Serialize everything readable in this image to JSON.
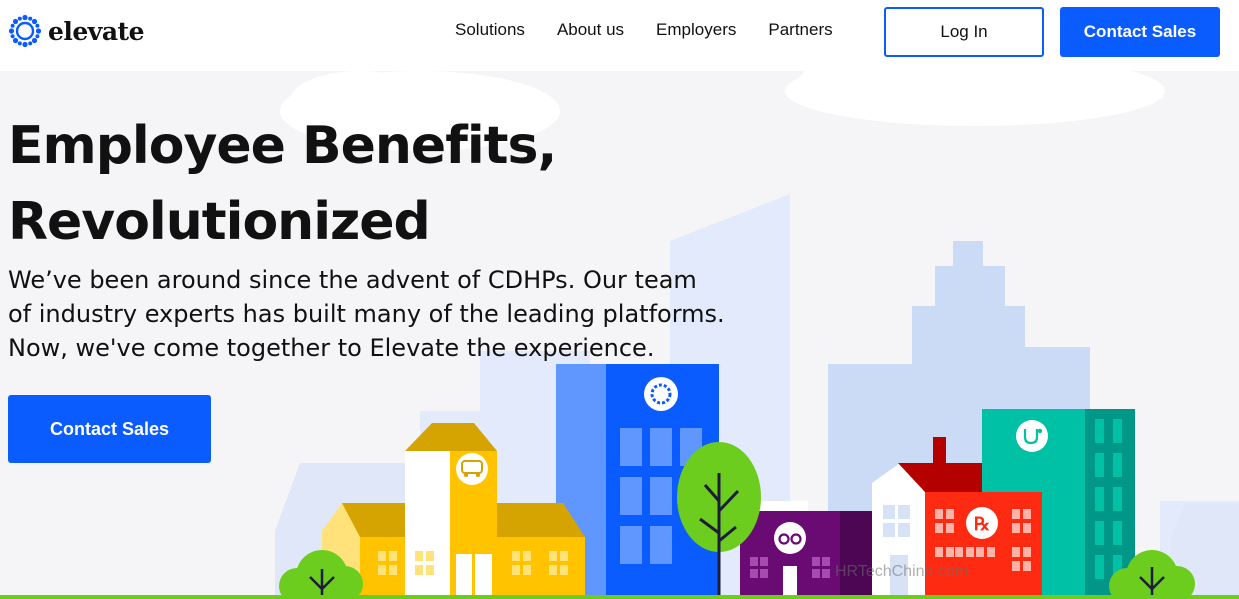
{
  "brand": {
    "name": "elevate",
    "primary_color": "#0b5cff"
  },
  "nav": {
    "links": [
      "Solutions",
      "About us",
      "Employers",
      "Partners"
    ],
    "login_label": "Log In",
    "contact_label": "Contact Sales"
  },
  "hero": {
    "title_lines": [
      "Employee Benefits,",
      "Revolutionized"
    ],
    "body_lines": [
      "We’ve been around since the advent of CDHPs. Our team",
      "of industry experts has built many of the leading platforms.",
      "Now, we've come together to Elevate the experience."
    ],
    "cta_label": "Contact Sales"
  },
  "illustration": {
    "pharmacy_symbol": "℞",
    "icons": [
      "elevate-logo-icon",
      "transport-icon",
      "glasses-icon",
      "stethoscope-icon",
      "rx-icon"
    ]
  },
  "watermark": "HRTechChina.com"
}
